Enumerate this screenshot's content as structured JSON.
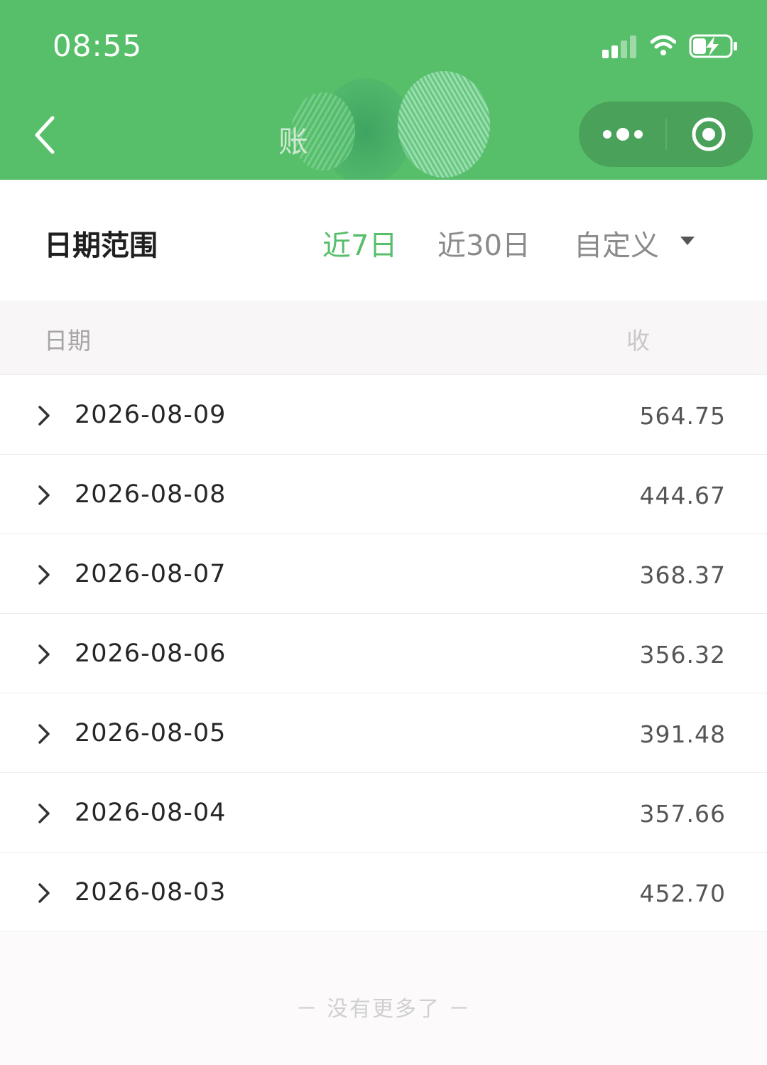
{
  "status_bar": {
    "time": "08:55"
  },
  "nav": {
    "title": "账"
  },
  "range": {
    "label": "日期范围",
    "tabs": [
      {
        "label": "近7日",
        "active": true
      },
      {
        "label": "近30日",
        "active": false
      },
      {
        "label": "自定义",
        "active": false
      }
    ]
  },
  "table": {
    "headers": {
      "date": "日期",
      "income": "收"
    },
    "rows": [
      {
        "date": "2026-08-09",
        "amount": "564.75"
      },
      {
        "date": "2026-08-08",
        "amount": "444.67"
      },
      {
        "date": "2026-08-07",
        "amount": "368.37"
      },
      {
        "date": "2026-08-06",
        "amount": "356.32"
      },
      {
        "date": "2026-08-05",
        "amount": "391.48"
      },
      {
        "date": "2026-08-04",
        "amount": "357.66"
      },
      {
        "date": "2026-08-03",
        "amount": "452.70"
      }
    ]
  },
  "footer": {
    "text": "－ 没有更多了 －"
  },
  "colors": {
    "accent": "#57bf6a",
    "capsule": "#4aa15a"
  }
}
